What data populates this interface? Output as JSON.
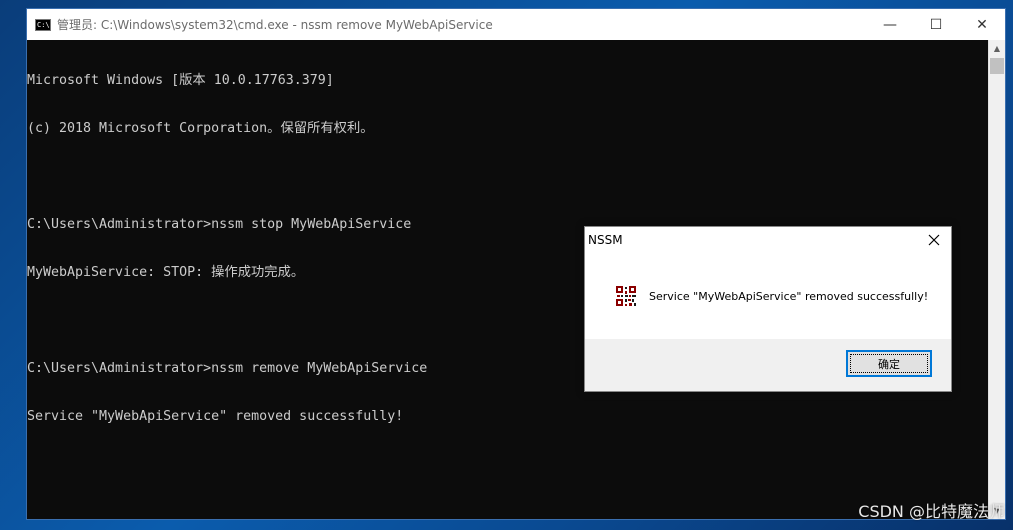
{
  "window": {
    "icon_text": "C:\\",
    "title": "管理员: C:\\Windows\\system32\\cmd.exe - nssm  remove MyWebApiService",
    "controls": {
      "minimize": "—",
      "maximize": "☐",
      "close": "✕"
    }
  },
  "console": {
    "lines": [
      "Microsoft Windows [版本 10.0.17763.379]",
      "(c) 2018 Microsoft Corporation。保留所有权利。",
      "",
      "C:\\Users\\Administrator>nssm stop MyWebApiService",
      "MyWebApiService: STOP: 操作成功完成。",
      "",
      "C:\\Users\\Administrator>nssm remove MyWebApiService",
      "Service \"MyWebApiService\" removed successfully!"
    ]
  },
  "dialog": {
    "title": "NSSM",
    "message": "Service \"MyWebApiService\" removed successfully!",
    "ok_label": "确定",
    "icon": "nssm-app-icon"
  },
  "watermark": "CSDN @比特魔法师",
  "colors": {
    "console_bg": "#0c0c0c",
    "console_text": "#cccccc",
    "accent": "#0078d7",
    "desktop": "#0b5cad"
  }
}
